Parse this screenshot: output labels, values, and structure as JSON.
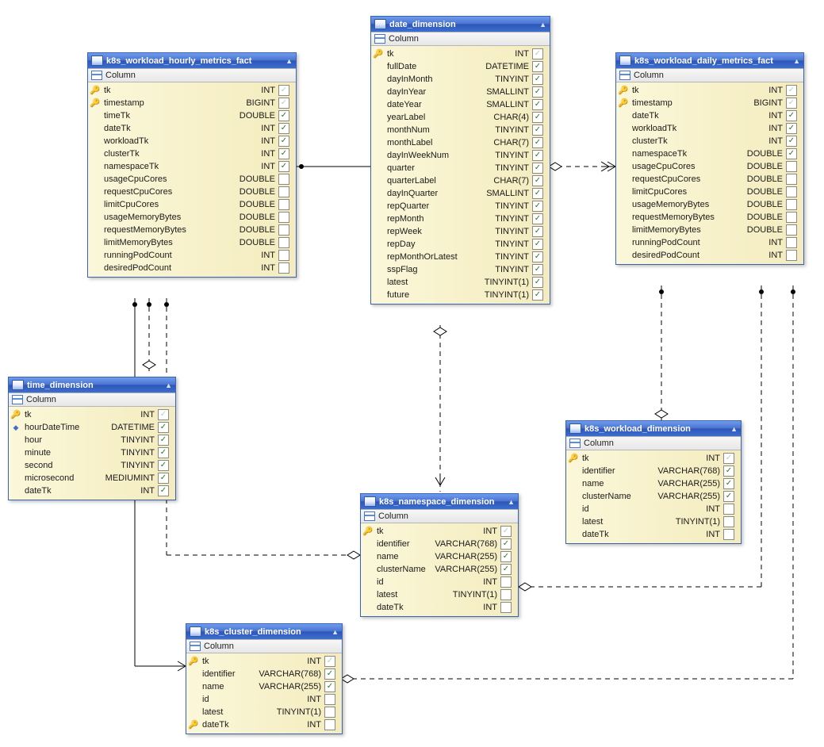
{
  "section_label": "Column",
  "tables": {
    "hourly": {
      "title": "k8s_workload_hourly_metrics_fact",
      "columns": [
        {
          "icon": "pk",
          "name": "tk",
          "type": "INT",
          "checked": "faded"
        },
        {
          "icon": "pk",
          "name": "timestamp",
          "type": "BIGINT",
          "checked": "faded"
        },
        {
          "icon": "",
          "name": "timeTk",
          "type": "DOUBLE",
          "checked": "true"
        },
        {
          "icon": "",
          "name": "dateTk",
          "type": "INT",
          "checked": "true"
        },
        {
          "icon": "",
          "name": "workloadTk",
          "type": "INT",
          "checked": "true"
        },
        {
          "icon": "",
          "name": "clusterTk",
          "type": "INT",
          "checked": "true"
        },
        {
          "icon": "",
          "name": "namespaceTk",
          "type": "INT",
          "checked": "true"
        },
        {
          "icon": "",
          "name": "usageCpuCores",
          "type": "DOUBLE",
          "checked": "false"
        },
        {
          "icon": "",
          "name": "requestCpuCores",
          "type": "DOUBLE",
          "checked": "false"
        },
        {
          "icon": "",
          "name": "limitCpuCores",
          "type": "DOUBLE",
          "checked": "false"
        },
        {
          "icon": "",
          "name": "usageMemoryBytes",
          "type": "DOUBLE",
          "checked": "false"
        },
        {
          "icon": "",
          "name": "requestMemoryBytes",
          "type": "DOUBLE",
          "checked": "false"
        },
        {
          "icon": "",
          "name": "limitMemoryBytes",
          "type": "DOUBLE",
          "checked": "false"
        },
        {
          "icon": "",
          "name": "runningPodCount",
          "type": "INT",
          "checked": "false"
        },
        {
          "icon": "",
          "name": "desiredPodCount",
          "type": "INT",
          "checked": "false"
        }
      ]
    },
    "daily": {
      "title": "k8s_workload_daily_metrics_fact",
      "columns": [
        {
          "icon": "pk",
          "name": "tk",
          "type": "INT",
          "checked": "faded"
        },
        {
          "icon": "pk",
          "name": "timestamp",
          "type": "BIGINT",
          "checked": "faded"
        },
        {
          "icon": "",
          "name": "dateTk",
          "type": "INT",
          "checked": "true"
        },
        {
          "icon": "",
          "name": "workloadTk",
          "type": "INT",
          "checked": "true"
        },
        {
          "icon": "",
          "name": "clusterTk",
          "type": "INT",
          "checked": "true"
        },
        {
          "icon": "",
          "name": "namespaceTk",
          "type": "DOUBLE",
          "checked": "true"
        },
        {
          "icon": "",
          "name": "usageCpuCores",
          "type": "DOUBLE",
          "checked": "false"
        },
        {
          "icon": "",
          "name": "requestCpuCores",
          "type": "DOUBLE",
          "checked": "false"
        },
        {
          "icon": "",
          "name": "limitCpuCores",
          "type": "DOUBLE",
          "checked": "false"
        },
        {
          "icon": "",
          "name": "usageMemoryBytes",
          "type": "DOUBLE",
          "checked": "false"
        },
        {
          "icon": "",
          "name": "requestMemoryBytes",
          "type": "DOUBLE",
          "checked": "false"
        },
        {
          "icon": "",
          "name": "limitMemoryBytes",
          "type": "DOUBLE",
          "checked": "false"
        },
        {
          "icon": "",
          "name": "runningPodCount",
          "type": "INT",
          "checked": "false"
        },
        {
          "icon": "",
          "name": "desiredPodCount",
          "type": "INT",
          "checked": "false"
        }
      ]
    },
    "date_dim": {
      "title": "date_dimension",
      "columns": [
        {
          "icon": "pk",
          "name": "tk",
          "type": "INT",
          "checked": "faded"
        },
        {
          "icon": "",
          "name": "fullDate",
          "type": "DATETIME",
          "checked": "true"
        },
        {
          "icon": "",
          "name": "dayInMonth",
          "type": "TINYINT",
          "checked": "true"
        },
        {
          "icon": "",
          "name": "dayInYear",
          "type": "SMALLINT",
          "checked": "true"
        },
        {
          "icon": "",
          "name": "dateYear",
          "type": "SMALLINT",
          "checked": "true"
        },
        {
          "icon": "",
          "name": "yearLabel",
          "type": "CHAR(4)",
          "checked": "true"
        },
        {
          "icon": "",
          "name": "monthNum",
          "type": "TINYINT",
          "checked": "true"
        },
        {
          "icon": "",
          "name": "monthLabel",
          "type": "CHAR(7)",
          "checked": "true"
        },
        {
          "icon": "",
          "name": "dayInWeekNum",
          "type": "TINYINT",
          "checked": "true"
        },
        {
          "icon": "",
          "name": "quarter",
          "type": "TINYINT",
          "checked": "true"
        },
        {
          "icon": "",
          "name": "quarterLabel",
          "type": "CHAR(7)",
          "checked": "true"
        },
        {
          "icon": "",
          "name": "dayInQuarter",
          "type": "SMALLINT",
          "checked": "true"
        },
        {
          "icon": "",
          "name": "repQuarter",
          "type": "TINYINT",
          "checked": "true"
        },
        {
          "icon": "",
          "name": "repMonth",
          "type": "TINYINT",
          "checked": "true"
        },
        {
          "icon": "",
          "name": "repWeek",
          "type": "TINYINT",
          "checked": "true"
        },
        {
          "icon": "",
          "name": "repDay",
          "type": "TINYINT",
          "checked": "true"
        },
        {
          "icon": "",
          "name": "repMonthOrLatest",
          "type": "TINYINT",
          "checked": "true"
        },
        {
          "icon": "",
          "name": "sspFlag",
          "type": "TINYINT",
          "checked": "true"
        },
        {
          "icon": "",
          "name": "latest",
          "type": "TINYINT(1)",
          "checked": "true"
        },
        {
          "icon": "",
          "name": "future",
          "type": "TINYINT(1)",
          "checked": "true"
        }
      ]
    },
    "time_dim": {
      "title": "time_dimension",
      "columns": [
        {
          "icon": "pk",
          "name": "tk",
          "type": "INT",
          "checked": "faded"
        },
        {
          "icon": "diamond",
          "name": "hourDateTime",
          "type": "DATETIME",
          "checked": "true"
        },
        {
          "icon": "",
          "name": "hour",
          "type": "TINYINT",
          "checked": "true"
        },
        {
          "icon": "",
          "name": "minute",
          "type": "TINYINT",
          "checked": "true"
        },
        {
          "icon": "",
          "name": "second",
          "type": "TINYINT",
          "checked": "true"
        },
        {
          "icon": "",
          "name": "microsecond",
          "type": "MEDIUMINT",
          "checked": "true"
        },
        {
          "icon": "",
          "name": "dateTk",
          "type": "INT",
          "checked": "true"
        }
      ]
    },
    "namespace_dim": {
      "title": "k8s_namespace_dimension",
      "columns": [
        {
          "icon": "pk",
          "name": "tk",
          "type": "INT",
          "checked": "faded"
        },
        {
          "icon": "",
          "name": "identifier",
          "type": "VARCHAR(768)",
          "checked": "true"
        },
        {
          "icon": "",
          "name": "name",
          "type": "VARCHAR(255)",
          "checked": "true"
        },
        {
          "icon": "",
          "name": "clusterName",
          "type": "VARCHAR(255)",
          "checked": "true"
        },
        {
          "icon": "",
          "name": "id",
          "type": "INT",
          "checked": "false"
        },
        {
          "icon": "",
          "name": "latest",
          "type": "TINYINT(1)",
          "checked": "false"
        },
        {
          "icon": "",
          "name": "dateTk",
          "type": "INT",
          "checked": "false"
        }
      ]
    },
    "cluster_dim": {
      "title": "k8s_cluster_dimension",
      "columns": [
        {
          "icon": "pk",
          "name": "tk",
          "type": "INT",
          "checked": "faded"
        },
        {
          "icon": "",
          "name": "identifier",
          "type": "VARCHAR(768)",
          "checked": "true"
        },
        {
          "icon": "",
          "name": "name",
          "type": "VARCHAR(255)",
          "checked": "true"
        },
        {
          "icon": "",
          "name": "id",
          "type": "INT",
          "checked": "false"
        },
        {
          "icon": "",
          "name": "latest",
          "type": "TINYINT(1)",
          "checked": "false"
        },
        {
          "icon": "pk",
          "name": "dateTk",
          "type": "INT",
          "checked": "false"
        }
      ]
    },
    "workload_dim": {
      "title": "k8s_workload_dimension",
      "columns": [
        {
          "icon": "pk",
          "name": "tk",
          "type": "INT",
          "checked": "faded"
        },
        {
          "icon": "",
          "name": "identifier",
          "type": "VARCHAR(768)",
          "checked": "true"
        },
        {
          "icon": "",
          "name": "name",
          "type": "VARCHAR(255)",
          "checked": "true"
        },
        {
          "icon": "",
          "name": "clusterName",
          "type": "VARCHAR(255)",
          "checked": "true"
        },
        {
          "icon": "",
          "name": "id",
          "type": "INT",
          "checked": "false"
        },
        {
          "icon": "",
          "name": "latest",
          "type": "TINYINT(1)",
          "checked": "false"
        },
        {
          "icon": "",
          "name": "dateTk",
          "type": "INT",
          "checked": "false"
        }
      ]
    }
  }
}
